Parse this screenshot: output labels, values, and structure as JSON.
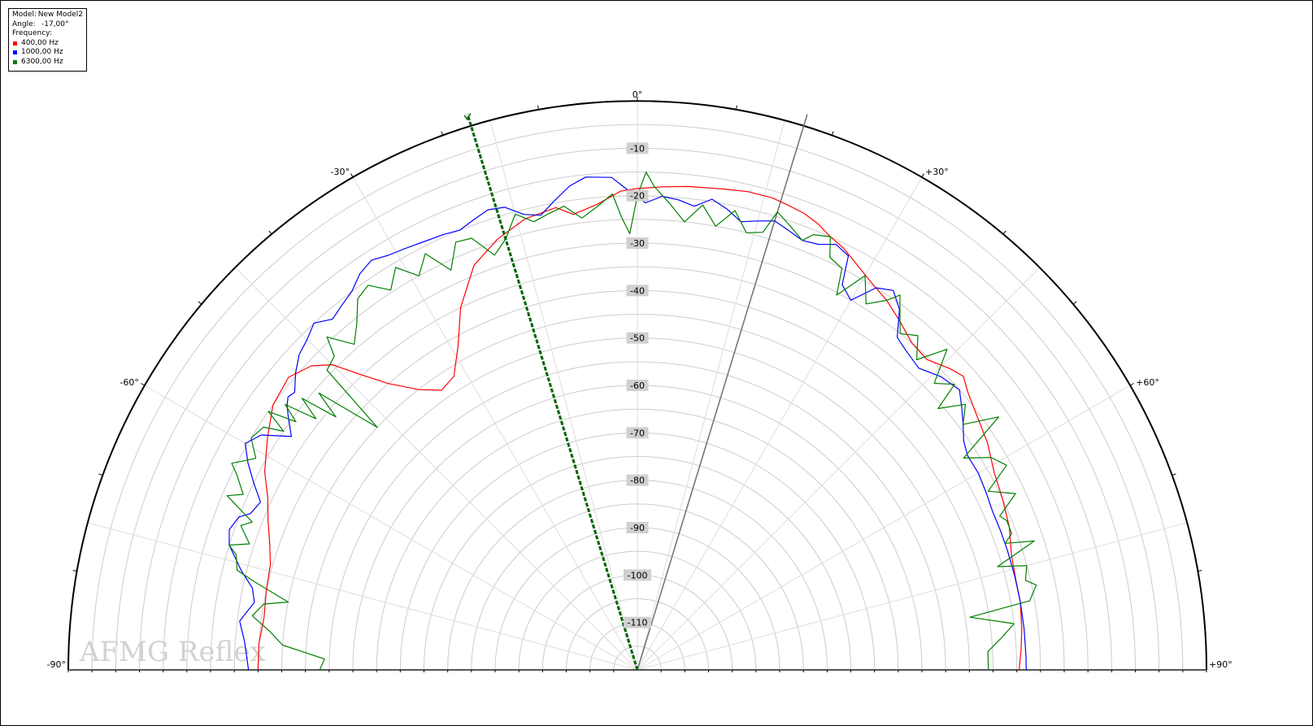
{
  "legend": {
    "model_key": "Model:",
    "model_value": "New Model2",
    "angle_key": "Angle:",
    "angle_value": "-17,00°",
    "frequency_key": "Frequency:",
    "entries": [
      {
        "label": "400,00 Hz",
        "color": "#ff0000"
      },
      {
        "label": "1000,00 Hz",
        "color": "#0000ff"
      },
      {
        "label": "6300,00 Hz",
        "color": "#008000"
      }
    ]
  },
  "watermark": "AFMG Reflex",
  "chart_data": {
    "type": "polar",
    "angle_range": [
      -90,
      90
    ],
    "radial_range": [
      -120,
      0
    ],
    "radial_unit": "dB",
    "angle_tick_labels": [
      {
        "angle": -90,
        "text": "-90°"
      },
      {
        "angle": -60,
        "text": "-60°"
      },
      {
        "angle": -30,
        "text": "-30°"
      },
      {
        "angle": 0,
        "text": "0°"
      },
      {
        "angle": 30,
        "text": "+30°"
      },
      {
        "angle": 60,
        "text": "+60°"
      },
      {
        "angle": 90,
        "text": "+90°"
      }
    ],
    "radial_ticks": [
      -10,
      -20,
      -30,
      -40,
      -50,
      -60,
      -70,
      -80,
      -90,
      -100,
      -110
    ],
    "radial_tick_labels": [
      "-10",
      "-20",
      "-30",
      "-40",
      "-50",
      "-60",
      "-70",
      "-80",
      "-90",
      "-100",
      "-110"
    ],
    "cursor_angle": -17,
    "reference_angle": 17,
    "colors": {
      "grid": "#cccccc",
      "outer": "#000000",
      "cursor": "#006400",
      "reference": "#707070"
    },
    "series": [
      {
        "name": "400,00 Hz",
        "color": "#ff0000",
        "points": [
          [
            -90,
            -40
          ],
          [
            -86,
            -40
          ],
          [
            -82,
            -40.5
          ],
          [
            -78,
            -40
          ],
          [
            -74,
            -39.5
          ],
          [
            -71,
            -38
          ],
          [
            -68,
            -36
          ],
          [
            -65,
            -34
          ],
          [
            -62,
            -31
          ],
          [
            -58,
            -28
          ],
          [
            -54,
            -25
          ],
          [
            -50,
            -24
          ],
          [
            -47,
            -26
          ],
          [
            -45,
            -29
          ],
          [
            -43,
            -35
          ],
          [
            -41,
            -40
          ],
          [
            -38,
            -45
          ],
          [
            -35,
            -48
          ],
          [
            -32,
            -47
          ],
          [
            -29,
            -42
          ],
          [
            -26,
            -35
          ],
          [
            -22,
            -28
          ],
          [
            -18,
            -24.5
          ],
          [
            -14,
            -22
          ],
          [
            -10,
            -21
          ],
          [
            -8,
            -23
          ],
          [
            -5,
            -21.5
          ],
          [
            -2,
            -19
          ],
          [
            0,
            -18.5
          ],
          [
            3,
            -18
          ],
          [
            6,
            -17.5
          ],
          [
            10,
            -17
          ],
          [
            13,
            -16.5
          ],
          [
            16,
            -16.5
          ],
          [
            18,
            -17
          ],
          [
            20,
            -17.5
          ],
          [
            22,
            -18.5
          ],
          [
            24,
            -20
          ],
          [
            26,
            -21
          ],
          [
            28,
            -22.5
          ],
          [
            31,
            -24.5
          ],
          [
            34,
            -26
          ],
          [
            37,
            -28
          ],
          [
            40,
            -30
          ],
          [
            43,
            -30.5
          ],
          [
            46,
            -28.5
          ],
          [
            48,
            -27.5
          ],
          [
            50,
            -29
          ],
          [
            53,
            -30.5
          ],
          [
            57,
            -32
          ],
          [
            61,
            -34
          ],
          [
            65,
            -35
          ],
          [
            69,
            -36
          ],
          [
            73,
            -37.5
          ],
          [
            77,
            -38
          ],
          [
            80,
            -38
          ],
          [
            84,
            -38.5
          ],
          [
            87,
            -39
          ],
          [
            90,
            -39.5
          ]
        ]
      },
      {
        "name": "1000,00 Hz",
        "color": "#0000ff",
        "points": [
          [
            -90,
            -38
          ],
          [
            -86,
            -37
          ],
          [
            -83,
            -35.5
          ],
          [
            -80,
            -38
          ],
          [
            -78,
            -37
          ],
          [
            -76,
            -34
          ],
          [
            -73,
            -30
          ],
          [
            -71,
            -29
          ],
          [
            -69,
            -30
          ],
          [
            -68,
            -32
          ],
          [
            -66,
            -33
          ],
          [
            -64,
            -30
          ],
          [
            -62,
            -27
          ],
          [
            -60,
            -24.5
          ],
          [
            -58,
            -26.5
          ],
          [
            -56,
            -32
          ],
          [
            -54,
            -29
          ],
          [
            -53,
            -27.5
          ],
          [
            -52,
            -26.5
          ],
          [
            -51,
            -27
          ],
          [
            -49,
            -24.5
          ],
          [
            -47,
            -22.5
          ],
          [
            -45,
            -21.5
          ],
          [
            -43,
            -20
          ],
          [
            -41,
            -22
          ],
          [
            -39,
            -21
          ],
          [
            -37,
            -20
          ],
          [
            -35,
            -18
          ],
          [
            -33,
            -17
          ],
          [
            -31,
            -18
          ],
          [
            -29,
            -18.5
          ],
          [
            -27,
            -19
          ],
          [
            -24,
            -19.5
          ],
          [
            -22,
            -20
          ],
          [
            -20,
            -19
          ],
          [
            -18,
            -18
          ],
          [
            -16,
            -18.5
          ],
          [
            -14,
            -21
          ],
          [
            -12,
            -22
          ],
          [
            -10,
            -19.5
          ],
          [
            -8,
            -17
          ],
          [
            -6,
            -15.5
          ],
          [
            -3,
            -16
          ],
          [
            -1,
            -19
          ],
          [
            1,
            -21.5
          ],
          [
            3,
            -20
          ],
          [
            5,
            -20.5
          ],
          [
            7,
            -21.5
          ],
          [
            9,
            -19.5
          ],
          [
            11,
            -21
          ],
          [
            13,
            -23
          ],
          [
            15,
            -22
          ],
          [
            17,
            -21
          ],
          [
            19,
            -22
          ],
          [
            21,
            -23
          ],
          [
            23,
            -22.5
          ],
          [
            25,
            -21
          ],
          [
            27,
            -22
          ],
          [
            28,
            -28
          ],
          [
            30,
            -30
          ],
          [
            32,
            -25
          ],
          [
            34,
            -23.5
          ],
          [
            36,
            -26
          ],
          [
            38,
            -31
          ],
          [
            40,
            -32
          ],
          [
            43,
            -33
          ],
          [
            46,
            -31
          ],
          [
            49,
            -30
          ],
          [
            51,
            -32
          ],
          [
            53,
            -34
          ],
          [
            55,
            -36
          ],
          [
            57,
            -37
          ],
          [
            60,
            -37
          ],
          [
            63,
            -37.5
          ],
          [
            66,
            -38
          ],
          [
            69,
            -38
          ],
          [
            72,
            -38
          ],
          [
            76,
            -38
          ],
          [
            80,
            -38
          ],
          [
            84,
            -38
          ],
          [
            88,
            -38
          ],
          [
            90,
            -38
          ]
        ]
      },
      {
        "name": "6300,00 Hz",
        "color": "#008000",
        "points": [
          [
            -90,
            -53
          ],
          [
            -88,
            -54
          ],
          [
            -86,
            -45
          ],
          [
            -84,
            -42
          ],
          [
            -82,
            -38
          ],
          [
            -80,
            -40
          ],
          [
            -79,
            -45
          ],
          [
            -77,
            -37
          ],
          [
            -76,
            -33
          ],
          [
            -74,
            -32
          ],
          [
            -73,
            -30
          ],
          [
            -72,
            -34
          ],
          [
            -70,
            -31
          ],
          [
            -69,
            -33
          ],
          [
            -67,
            -26
          ],
          [
            -66,
            -29
          ],
          [
            -64,
            -26
          ],
          [
            -63,
            -24
          ],
          [
            -61,
            -28
          ],
          [
            -59,
            -25
          ],
          [
            -57,
            -26
          ],
          [
            -56,
            -30
          ],
          [
            -55,
            -25
          ],
          [
            -54,
            -31
          ],
          [
            -53,
            -27
          ],
          [
            -52,
            -34
          ],
          [
            -51,
            -29
          ],
          [
            -50,
            -37
          ],
          [
            -49,
            -31
          ],
          [
            -47,
            -45
          ],
          [
            -46,
            -29
          ],
          [
            -44,
            -28
          ],
          [
            -43,
            -24
          ],
          [
            -41,
            -29
          ],
          [
            -39,
            -26
          ],
          [
            -37,
            -22
          ],
          [
            -35,
            -21
          ],
          [
            -33,
            -24.5
          ],
          [
            -31,
            -21
          ],
          [
            -29,
            -25
          ],
          [
            -27,
            -21.5
          ],
          [
            -25,
            -27
          ],
          [
            -23,
            -22
          ],
          [
            -21,
            -22.5
          ],
          [
            -19,
            -27.5
          ],
          [
            -17,
            -25
          ],
          [
            -15,
            -20.5
          ],
          [
            -13,
            -23
          ],
          [
            -11,
            -22
          ],
          [
            -9,
            -21
          ],
          [
            -7,
            -24
          ],
          [
            -5,
            -22
          ],
          [
            -3,
            -19.5
          ],
          [
            -2,
            -24.5
          ],
          [
            -1,
            -28
          ],
          [
            0,
            -20
          ],
          [
            1,
            -15
          ],
          [
            2,
            -18
          ],
          [
            4,
            -21.5
          ],
          [
            6,
            -25
          ],
          [
            8,
            -21
          ],
          [
            10,
            -25
          ],
          [
            12,
            -21
          ],
          [
            14,
            -25
          ],
          [
            16,
            -24
          ],
          [
            17,
            -19
          ],
          [
            19,
            -21
          ],
          [
            21,
            -23
          ],
          [
            22,
            -21
          ],
          [
            24,
            -20
          ],
          [
            25,
            -24
          ],
          [
            27,
            -25
          ],
          [
            28,
            -30.5
          ],
          [
            30,
            -24
          ],
          [
            32,
            -29
          ],
          [
            34,
            -26
          ],
          [
            35,
            -23.5
          ],
          [
            37,
            -28
          ],
          [
            38,
            -30
          ],
          [
            40,
            -28
          ],
          [
            42,
            -32
          ],
          [
            44,
            -26
          ],
          [
            46,
            -33
          ],
          [
            48,
            -30
          ],
          [
            49,
            -36
          ],
          [
            51,
            -31
          ],
          [
            53,
            -34
          ],
          [
            55,
            -27
          ],
          [
            57,
            -38
          ],
          [
            59,
            -33
          ],
          [
            61,
            -31
          ],
          [
            63,
            -37
          ],
          [
            65,
            -32
          ],
          [
            67,
            -37
          ],
          [
            68,
            -36
          ],
          [
            70,
            -36
          ],
          [
            71,
            -38
          ],
          [
            72,
            -32
          ],
          [
            74,
            -41
          ],
          [
            75,
            -35
          ],
          [
            77,
            -36
          ],
          [
            78,
            -34
          ],
          [
            80,
            -36
          ],
          [
            81,
            -49
          ],
          [
            83,
            -40
          ],
          [
            85,
            -43
          ],
          [
            87,
            -46
          ],
          [
            90,
            -46
          ]
        ]
      }
    ]
  }
}
